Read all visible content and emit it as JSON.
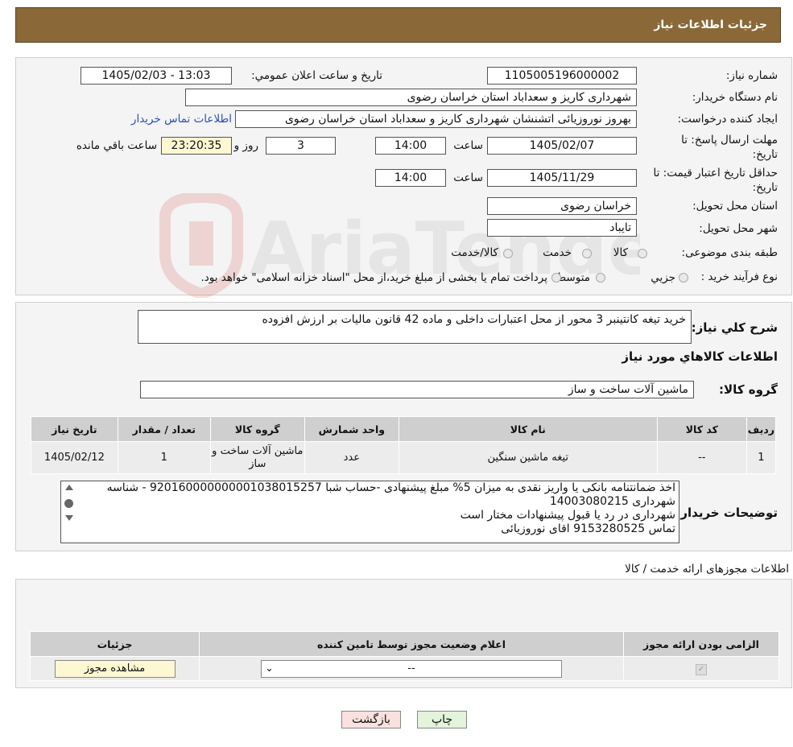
{
  "header": {
    "title": "جزئیات اطلاعات نیاز"
  },
  "fields": {
    "need_number_label": "شماره نیاز:",
    "need_number": "1105005196000002",
    "announce_label": "تاریخ و ساعت اعلان عمومي:",
    "announce_value": "1405/02/03 - 13:03",
    "buyer_org_label": "نام دستگاه خریدار:",
    "buyer_org": "شهرداری کاریز و سعداباد استان خراسان رضوی",
    "creator_label": "ایجاد کننده درخواست:",
    "creator": "بهروز نوروزیائی اتشنشان شهرداری کاریز و سعداباد استان خراسان رضوی",
    "contact_link": "اطلاعات تماس خریدار",
    "reply_deadline_label": "مهلت ارسال پاسخ: تا تاریخ:",
    "reply_date": "1405/02/07",
    "time_label": "ساعت",
    "reply_time": "14:00",
    "days_value": "3",
    "days_label": "روز و",
    "remaining_time": "23:20:35",
    "remaining_label": "ساعت باقي مانده",
    "price_validity_label": "حداقل تاریخ اعتبار قیمت: تا تاریخ:",
    "price_date": "1405/11/29",
    "price_time": "14:00",
    "province_label": "استان محل تحویل:",
    "province": "خراسان رضوی",
    "city_label": "شهر محل تحویل:",
    "city": "تایباد",
    "category_label": "طبقه بندی موضوعی:",
    "category_options": [
      "کالا",
      "خدمت",
      "کالا/خدمت"
    ],
    "process_label": "نوع فرآیند خرید :",
    "process_options": [
      "جزيي",
      "متوسط"
    ],
    "process_note": "پرداخت تمام یا بخشی از مبلغ خرید،از محل \"اسناد خزانه اسلامی\" خواهد بود."
  },
  "summary": {
    "label": "شرح کلي نیاز:",
    "text": "خرید تیغه کانتینبر 3 محور از محل اعتبارات داخلی و ماده 42 قانون مالیات بر ارزش افزوده",
    "goods_info_title": "اطلاعات کالاهاي مورد نیاز",
    "group_label": "گروه کالا:",
    "group_value": "ماشین آلات ساخت و ساز"
  },
  "goods_table": {
    "headers": [
      "رديف",
      "کد کالا",
      "نام کالا",
      "واحد شمارش",
      "گروه کالا",
      "تعداد / مقدار",
      "تاریخ نیاز"
    ],
    "rows": [
      [
        "1",
        "--",
        "تیغه ماشین سنگین",
        "عدد",
        "ماشین آلات ساخت و ساز",
        "1",
        "1405/02/12"
      ]
    ]
  },
  "buyer_notes": {
    "label": "توضیحات خریدار:",
    "lines": [
      "اخذ ضمانتنامه بانکی یا واریز نقدی به میزان 5% مبلغ پیشنهادی -حساب شبا 920160000000001038015257 - شناسه شهرداری 14003080215",
      "شهرداری در رد یا قبول پیشنهادات مختار است",
      "تماس 9153280525 اقای نوروزیائی"
    ]
  },
  "licenses": {
    "title": "اطلاعات مجوزهای ارائه خدمت / کالا",
    "headers": [
      "الزامی بودن ارائه مجوز",
      "اعلام وضعیت مجوز توسط تامین کننده",
      "جزئیات"
    ],
    "select_value": "--",
    "view_button": "مشاهده مجوز"
  },
  "buttons": {
    "print": "چاپ",
    "back": "بازگشت"
  },
  "watermark": {
    "text": "AriaTender.neT"
  }
}
